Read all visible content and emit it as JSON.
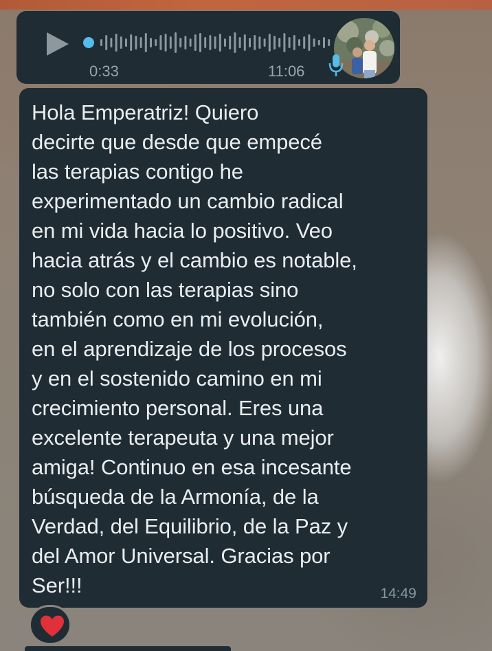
{
  "voice_message": {
    "duration": "0:33",
    "time": "11:06",
    "progress": 0.0,
    "icons": [
      "play-icon",
      "microphone-icon",
      "avatar"
    ]
  },
  "text_message": {
    "lines": [
      "Hola Emperatriz! Quiero",
      "decirte que desde que empecé",
      "las terapias contigo he",
      "experimentado un cambio radical",
      "en mi vida hacia lo positivo. Veo",
      "hacia atrás y el cambio es notable,",
      "no solo con las terapias sino",
      "también como en mi evolución,",
      "en el aprendizaje de los procesos",
      "y en el sostenido camino en mi",
      "crecimiento personal. Eres una",
      "excelente terapeuta y una mejor",
      "amiga! Continuo en esa incesante",
      "búsqueda de la Armonía, de la",
      "Verdad, del Equilibrio, de la Paz y",
      "del Amor Universal. Gracias por",
      "Ser!!!"
    ],
    "time": "14:49"
  },
  "reaction": {
    "icon": "heart-icon",
    "color": "#e0303a"
  },
  "colors": {
    "bubble": "#1f2c34",
    "text": "#e9edef",
    "meta": "#9aa5ac",
    "accent": "#53bdeb"
  }
}
